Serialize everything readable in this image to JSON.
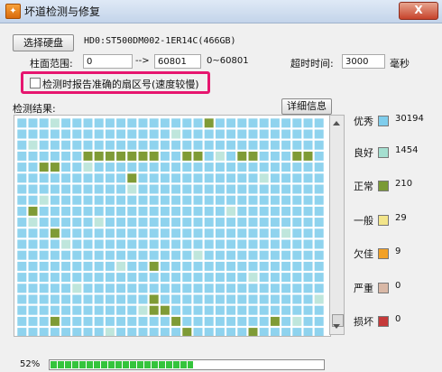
{
  "window": {
    "title": "坏道检测与修复",
    "close_label": "X"
  },
  "disk": {
    "select_button": "选择硬盘",
    "disk_info": "HD0:ST500DM002-1ER14C(466GB)"
  },
  "range": {
    "label": "柱面范围:",
    "start": "0",
    "arrow": "-->",
    "end": "60801",
    "hint": "0~60801"
  },
  "timeout": {
    "label": "超时时间:",
    "value": "3000",
    "unit": "毫秒"
  },
  "option": {
    "check_label": "检测时报告准确的扇区号(速度较慢)",
    "checked": false
  },
  "results": {
    "label": "检测结果:",
    "details_button": "详细信息"
  },
  "legend": [
    {
      "name": "优秀",
      "color": "#7fcdec",
      "count": "30194"
    },
    {
      "name": "良好",
      "color": "#a5dfd0",
      "count": "1454"
    },
    {
      "name": "正常",
      "color": "#7a9a35",
      "count": "210"
    },
    {
      "name": "一般",
      "color": "#f3e58a",
      "count": "29"
    },
    {
      "name": "欠佳",
      "color": "#f2a126",
      "count": "9"
    },
    {
      "name": "严重",
      "color": "#d9b8a6",
      "count": "0"
    },
    {
      "name": "损坏",
      "color": "#c53a3a",
      "count": "0"
    }
  ],
  "grid": {
    "colors": {
      "excellent": "#8fd3ee",
      "good": "#bfe6dc",
      "normal": "#7f9b36",
      "pending": "#ffffff"
    },
    "good_cells": [
      [
        0,
        3
      ],
      [
        1,
        14
      ],
      [
        2,
        1
      ],
      [
        3,
        18
      ],
      [
        4,
        6
      ],
      [
        5,
        22
      ],
      [
        6,
        10
      ],
      [
        7,
        2
      ],
      [
        8,
        19
      ],
      [
        9,
        1
      ],
      [
        9,
        7
      ],
      [
        10,
        24
      ],
      [
        11,
        4
      ],
      [
        12,
        16
      ],
      [
        13,
        9
      ],
      [
        14,
        21
      ],
      [
        15,
        5
      ],
      [
        16,
        27
      ],
      [
        17,
        11
      ],
      [
        18,
        25
      ],
      [
        19,
        8
      ]
    ],
    "normal_cells": [
      [
        0,
        17
      ],
      [
        3,
        6
      ],
      [
        3,
        7
      ],
      [
        3,
        8
      ],
      [
        3,
        9
      ],
      [
        3,
        10
      ],
      [
        3,
        11
      ],
      [
        3,
        12
      ],
      [
        3,
        15
      ],
      [
        3,
        16
      ],
      [
        3,
        20
      ],
      [
        3,
        21
      ],
      [
        3,
        25
      ],
      [
        3,
        26
      ],
      [
        4,
        2
      ],
      [
        4,
        3
      ],
      [
        5,
        10
      ],
      [
        8,
        1
      ],
      [
        10,
        3
      ],
      [
        13,
        12
      ],
      [
        16,
        12
      ],
      [
        17,
        12
      ],
      [
        17,
        13
      ],
      [
        18,
        3
      ],
      [
        18,
        14
      ],
      [
        18,
        23
      ],
      [
        19,
        15
      ],
      [
        19,
        21
      ]
    ],
    "pending_cells": [
      [
        20,
        25
      ],
      [
        20,
        26
      ],
      [
        20,
        27
      ]
    ]
  },
  "progress": {
    "percent_label": "52%",
    "fraction": 0.52
  }
}
